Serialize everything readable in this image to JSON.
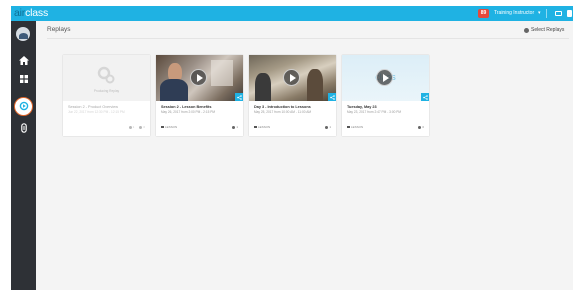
{
  "app": {
    "logo_air": "air",
    "logo_rest": "class"
  },
  "topbar": {
    "badge": "89",
    "user_name": "Training Instructor",
    "caret": "▾"
  },
  "page": {
    "title": "Replays",
    "select_label": "Select Replays"
  },
  "cards": [
    {
      "title": "Session 2 - Product Overview",
      "date": "Jun 22, 2017 from 12:30 PM - 12:15 PM",
      "processing": "Producing Replay",
      "tag": "",
      "count1": "1",
      "count2": "0"
    },
    {
      "title": "Session 2 - Lesson Benefits",
      "date": "May 26, 2017 from 2:00 PM - 2:15 PM",
      "tag": "LESSON",
      "count": "1"
    },
    {
      "title": "Day 3 - Introduction to Lessons",
      "date": "May 25, 2017 from 10:00 AM - 11:00 AM",
      "tag": "LESSON",
      "count": "1"
    },
    {
      "title": "Tuesday, May 23",
      "date": "May 23, 2017 from 2:47 PM - 3:00 PM",
      "tag": "LESSON",
      "count": "0",
      "thumb_text": "class"
    }
  ],
  "colors": {
    "topbar": "#1fb2e3",
    "sidebar": "#2e3136",
    "active_ring": "#e2672b",
    "share": "#1fb2e3"
  },
  "icons": [
    "home-icon",
    "grid-icon",
    "replays-icon",
    "attachment-icon",
    "share-icon",
    "play-icon"
  ]
}
